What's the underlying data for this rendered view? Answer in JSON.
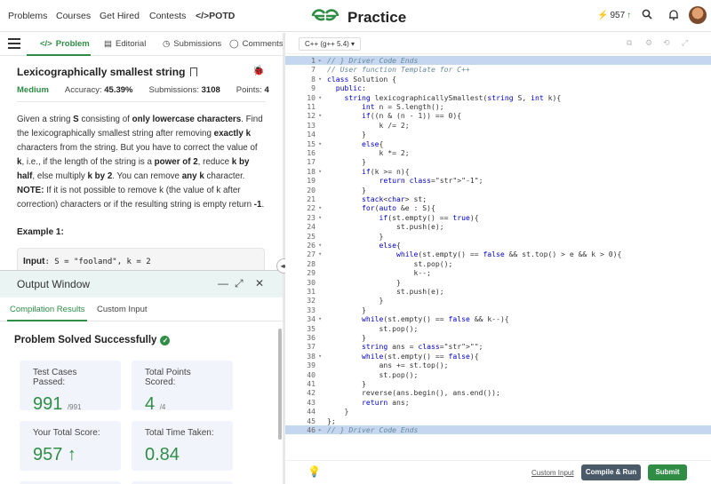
{
  "nav": {
    "problems": "Problems",
    "courses": "Courses",
    "get_hired": "Get Hired",
    "contests": "Contests",
    "potd": "</>POTD",
    "logo_mark": "GG",
    "logo_text": "Practice",
    "streak_value": "957",
    "icons": [
      "bolt-icon",
      "arrow-up-icon",
      "search-icon",
      "bell-icon",
      "theme-toggle-icon",
      "avatar"
    ]
  },
  "left_tabs": {
    "problem": "Problem",
    "editorial": "Editorial",
    "submissions": "Submissions",
    "comments": "Comments"
  },
  "problem": {
    "title": "Lexicographically smallest string",
    "difficulty": "Medium",
    "accuracy_label": "Accuracy:",
    "accuracy": "45.39%",
    "submissions_label": "Submissions:",
    "submissions": "3108",
    "points_label": "Points:",
    "points": "4",
    "desc_1": "Given a string ",
    "desc_S": "S",
    "desc_2": " consisting of ",
    "desc_only": "only lowercase characters",
    "desc_3": ". Find the lexicographically smallest string after removing ",
    "desc_exactly": "exactly k",
    "desc_4": " characters from the string. But you have to correct the value of ",
    "desc_k": "k",
    "desc_5": ", i.e., if the length of the string is a ",
    "desc_pow": "power of 2",
    "desc_6": ", reduce ",
    "desc_half": "k by half",
    "desc_7": ", else multiply ",
    "desc_by2": "k by 2",
    "desc_8": ". You can remove ",
    "desc_any": "any k",
    "desc_9": " character.",
    "note_label": "NOTE:",
    "note_text": " If it is not possible to remove k (the value of k after correction) characters or if the resulting string is empty return ",
    "note_ret": "-1",
    "note_end": ".",
    "example_head": "Example 1:",
    "example_input_label": "Input",
    "example_input": ": S = \"fooland\", k = 2"
  },
  "output": {
    "title": "Output Window",
    "tab_compilation": "Compilation Results",
    "tab_custom": "Custom Input",
    "result": "Problem Solved Successfully",
    "cards": {
      "tests_label": "Test Cases Passed:",
      "tests_value": "991",
      "tests_total": "/991",
      "points_label": "Total Points Scored:",
      "points_value": "4",
      "points_total": "/4",
      "score_label": "Your Total Score:",
      "score_value": "957",
      "time_label": "Total Time Taken:",
      "time_value": "0.84"
    }
  },
  "editor": {
    "language": "C++ (g++ 5.4) ▾",
    "custom_input": "Custom Input",
    "compile_run": "Compile & Run",
    "submit": "Submit",
    "lines": [
      {
        "n": "1",
        "fold": "▸",
        "text": "// } Driver Code Ends"
      },
      {
        "n": "7",
        "fold": "",
        "text": "// User function Template for C++"
      },
      {
        "n": "8",
        "fold": "▾",
        "text": "class Solution {"
      },
      {
        "n": "9",
        "fold": "",
        "text": "  public:"
      },
      {
        "n": "10",
        "fold": "▾",
        "text": "    string lexicographicallySmallest(string S, int k){"
      },
      {
        "n": "11",
        "fold": "",
        "text": "        int n = S.length();"
      },
      {
        "n": "12",
        "fold": "▾",
        "text": "        if((n & (n - 1)) == 0){"
      },
      {
        "n": "13",
        "fold": "",
        "text": "            k /= 2;"
      },
      {
        "n": "14",
        "fold": "",
        "text": "        }"
      },
      {
        "n": "15",
        "fold": "▾",
        "text": "        else{"
      },
      {
        "n": "16",
        "fold": "",
        "text": "            k *= 2;"
      },
      {
        "n": "17",
        "fold": "",
        "text": "        }"
      },
      {
        "n": "18",
        "fold": "▾",
        "text": "        if(k >= n){"
      },
      {
        "n": "19",
        "fold": "",
        "text": "            return \"-1\";"
      },
      {
        "n": "20",
        "fold": "",
        "text": "        }"
      },
      {
        "n": "21",
        "fold": "",
        "text": "        stack<char> st;"
      },
      {
        "n": "22",
        "fold": "▾",
        "text": "        for(auto &e : S){"
      },
      {
        "n": "23",
        "fold": "▾",
        "text": "            if(st.empty() == true){"
      },
      {
        "n": "24",
        "fold": "",
        "text": "                st.push(e);"
      },
      {
        "n": "25",
        "fold": "",
        "text": "            }"
      },
      {
        "n": "26",
        "fold": "▾",
        "text": "            else{"
      },
      {
        "n": "27",
        "fold": "▾",
        "text": "                while(st.empty() == false && st.top() > e && k > 0){"
      },
      {
        "n": "28",
        "fold": "",
        "text": "                    st.pop();"
      },
      {
        "n": "29",
        "fold": "",
        "text": "                    k--;"
      },
      {
        "n": "30",
        "fold": "",
        "text": "                }"
      },
      {
        "n": "31",
        "fold": "",
        "text": "                st.push(e);"
      },
      {
        "n": "32",
        "fold": "",
        "text": "            }"
      },
      {
        "n": "33",
        "fold": "",
        "text": "        }"
      },
      {
        "n": "34",
        "fold": "▾",
        "text": "        while(st.empty() == false && k--){"
      },
      {
        "n": "35",
        "fold": "",
        "text": "            st.pop();"
      },
      {
        "n": "36",
        "fold": "",
        "text": "        }"
      },
      {
        "n": "37",
        "fold": "",
        "text": "        string ans = \"\";"
      },
      {
        "n": "38",
        "fold": "▾",
        "text": "        while(st.empty() == false){"
      },
      {
        "n": "39",
        "fold": "",
        "text": "            ans += st.top();"
      },
      {
        "n": "40",
        "fold": "",
        "text": "            st.pop();"
      },
      {
        "n": "41",
        "fold": "",
        "text": "        }"
      },
      {
        "n": "42",
        "fold": "",
        "text": "        reverse(ans.begin(), ans.end());"
      },
      {
        "n": "43",
        "fold": "",
        "text": "        return ans;"
      },
      {
        "n": "44",
        "fold": "",
        "text": "    }"
      },
      {
        "n": "45",
        "fold": "",
        "text": "};"
      },
      {
        "n": "46",
        "fold": "▸",
        "text": "// } Driver Code Ends"
      }
    ]
  },
  "colors": {
    "brand_green": "#2f8d46",
    "button_dark": "#4a5a68",
    "card_bg": "#f1f5fb"
  }
}
